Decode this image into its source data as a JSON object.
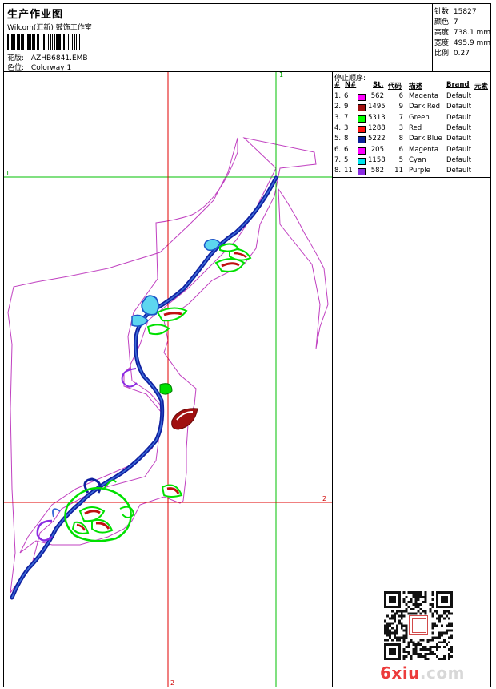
{
  "header": {
    "title": "生产作业图",
    "subtitle": "Wilcom(汇新) 鼓饰工作室",
    "design_label": "花版:",
    "design_value": "AZHB6841.EMB",
    "colorway_label": "色位:",
    "colorway_value": "Colorway 1"
  },
  "stats": [
    {
      "label": "针数:",
      "value": "15827"
    },
    {
      "label": "颜色:",
      "value": "7"
    },
    {
      "label": "高度:",
      "value": "738.1 mm"
    },
    {
      "label": "宽度:",
      "value": "495.9 mm"
    },
    {
      "label": "比例:",
      "value": "0.27"
    }
  ],
  "stop_sequence": {
    "title": "停止顺序:",
    "headers": [
      "#",
      "N#",
      "St.",
      "代码",
      "描述",
      "Brand",
      "元素"
    ],
    "rows": [
      {
        "idx": "1.",
        "n": "6",
        "color": "#ff00ff",
        "st": "562",
        "code": "6",
        "desc": "Magenta",
        "brand": "Default"
      },
      {
        "idx": "2.",
        "n": "9",
        "color": "#a01010",
        "st": "1495",
        "code": "9",
        "desc": "Dark Red",
        "brand": "Default"
      },
      {
        "idx": "3.",
        "n": "7",
        "color": "#00ff00",
        "st": "5313",
        "code": "7",
        "desc": "Green",
        "brand": "Default"
      },
      {
        "idx": "4.",
        "n": "3",
        "color": "#ff1010",
        "st": "1288",
        "code": "3",
        "desc": "Red",
        "brand": "Default"
      },
      {
        "idx": "5.",
        "n": "8",
        "color": "#0a1f9a",
        "st": "5222",
        "code": "8",
        "desc": "Dark Blue",
        "brand": "Default"
      },
      {
        "idx": "6.",
        "n": "6",
        "color": "#ff00ff",
        "st": "205",
        "code": "6",
        "desc": "Magenta",
        "brand": "Default"
      },
      {
        "idx": "7.",
        "n": "5",
        "color": "#00e5ee",
        "st": "1158",
        "code": "5",
        "desc": "Cyan",
        "brand": "Default"
      },
      {
        "idx": "8.",
        "n": "11",
        "color": "#8a2be2",
        "st": "582",
        "code": "11",
        "desc": "Purple",
        "brand": "Default"
      }
    ]
  },
  "markers": {
    "v1": "1",
    "h1": "1",
    "h2": "2",
    "v2": "2"
  },
  "watermark": {
    "part1": "6xiu",
    "part2": ".com"
  },
  "colors": {
    "guide_green": "#00c000",
    "guide_red": "#e00000",
    "outline": "#c040c0"
  }
}
